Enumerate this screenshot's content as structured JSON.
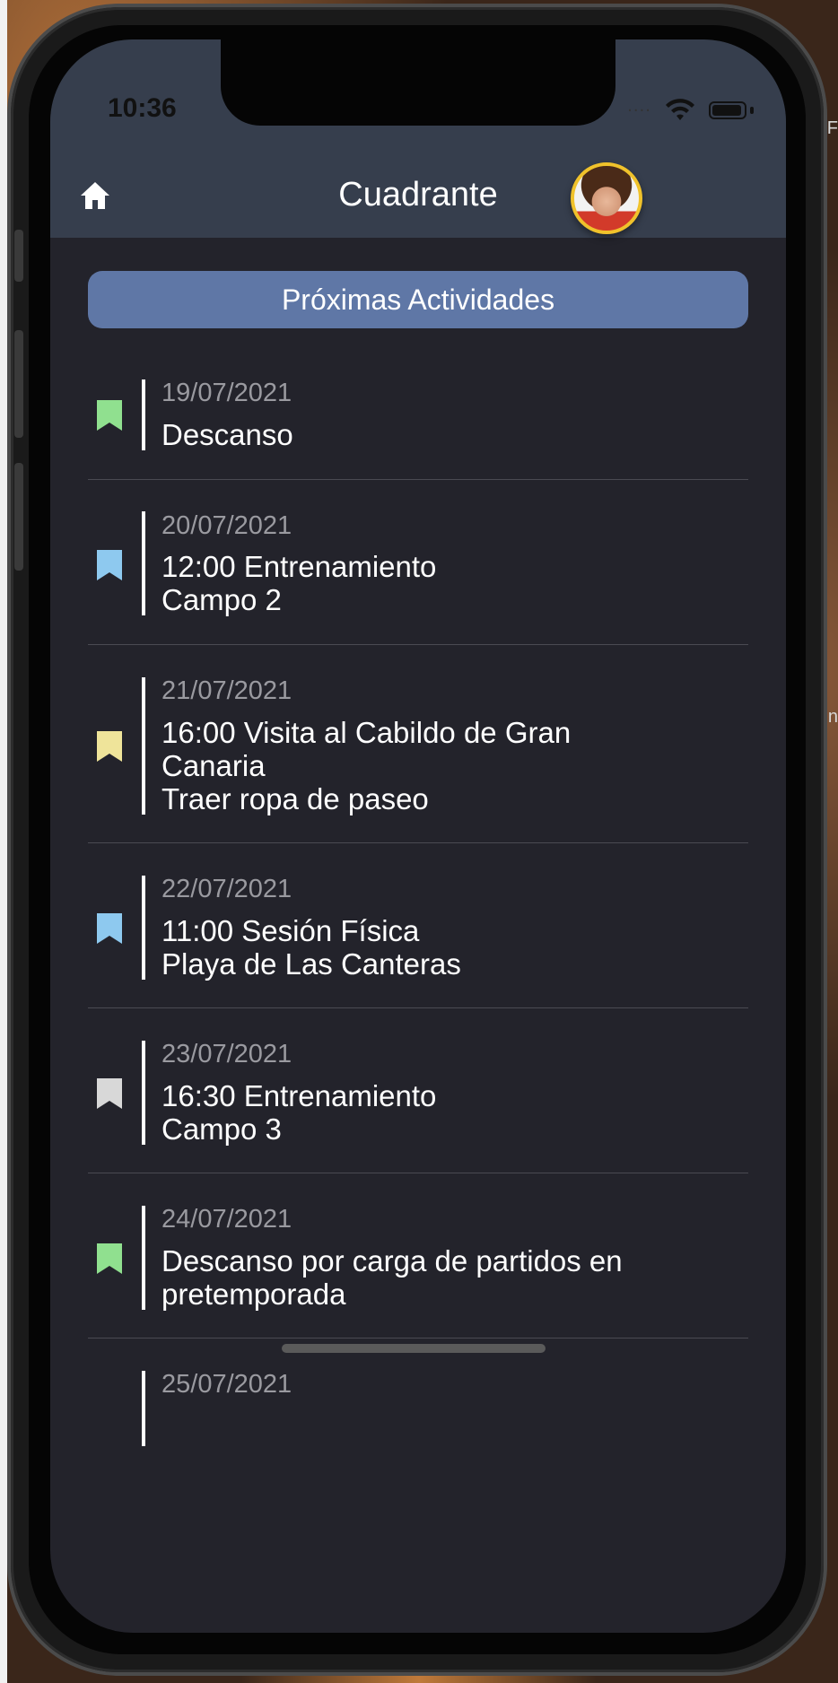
{
  "status_bar": {
    "time": "10:36",
    "signal": "····"
  },
  "header": {
    "title": "Cuadrante"
  },
  "section_button": {
    "label": "Próximas Actividades"
  },
  "activities": [
    {
      "date": "19/07/2021",
      "text": "Descanso",
      "color": "#90e08f"
    },
    {
      "date": "20/07/2021",
      "text": "12:00 Entrenamiento\nCampo 2",
      "color": "#8ec9ef"
    },
    {
      "date": "21/07/2021",
      "text": "16:00 Visita al Cabildo de Gran\nCanaria\nTraer ropa de paseo",
      "color": "#efe49a"
    },
    {
      "date": "22/07/2021",
      "text": "11:00 Sesión Física\nPlaya de Las Canteras",
      "color": "#8ec9ef"
    },
    {
      "date": "23/07/2021",
      "text": "16:30 Entrenamiento\nCampo 3",
      "color": "#d8d8d8"
    },
    {
      "date": "24/07/2021",
      "text": "Descanso por carga de partidos en\npretemporada",
      "color": "#90e08f"
    },
    {
      "date": "25/07/2021",
      "text": "",
      "color": ""
    }
  ],
  "background_side_texts": [
    "F",
    "n"
  ]
}
